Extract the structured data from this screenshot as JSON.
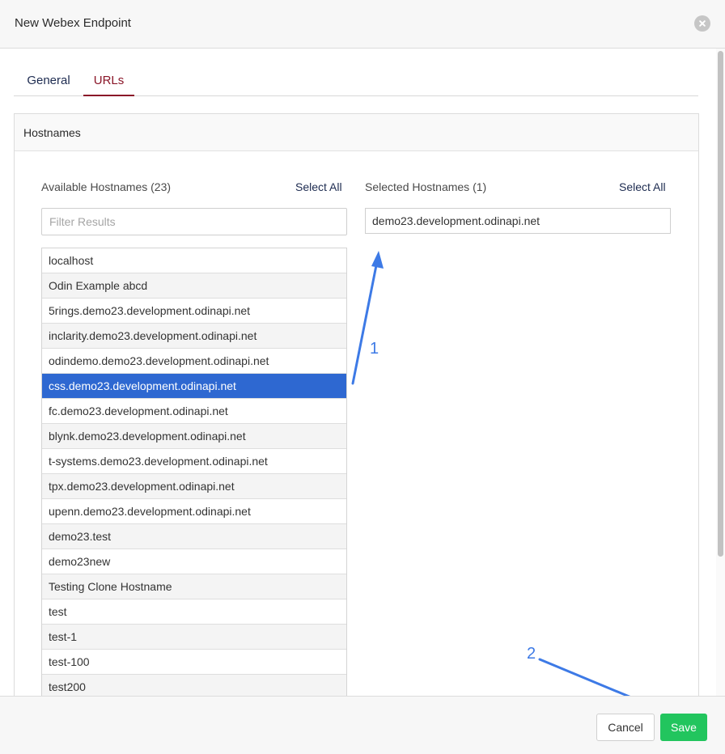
{
  "dialog": {
    "title": "New Webex Endpoint"
  },
  "tabs": [
    {
      "label": "General",
      "active": false
    },
    {
      "label": "URLs",
      "active": true
    }
  ],
  "panel": {
    "title": "Hostnames"
  },
  "available": {
    "title": "Available Hostnames (23)",
    "select_all": "Select All",
    "filter_placeholder": "Filter Results",
    "items": [
      "localhost",
      "Odin Example abcd",
      "5rings.demo23.development.odinapi.net",
      "inclarity.demo23.development.odinapi.net",
      "odindemo.demo23.development.odinapi.net",
      "css.demo23.development.odinapi.net",
      "fc.demo23.development.odinapi.net",
      "blynk.demo23.development.odinapi.net",
      "t-systems.demo23.development.odinapi.net",
      "tpx.demo23.development.odinapi.net",
      "upenn.demo23.development.odinapi.net",
      "demo23.test",
      "demo23new",
      "Testing Clone Hostname",
      "test",
      "test-1",
      "test-100",
      "test200"
    ],
    "selected_index": 5
  },
  "selected": {
    "title": "Selected Hostnames (1)",
    "select_all": "Select All",
    "items": [
      "demo23.development.odinapi.net"
    ]
  },
  "annotations": {
    "label_1": "1",
    "label_2": "2",
    "color": "#3d7ae6"
  },
  "footer": {
    "cancel_label": "Cancel",
    "save_label": "Save"
  },
  "colors": {
    "accent_tab": "#8a1628",
    "selection": "#2e68d1",
    "save": "#22c55e"
  }
}
